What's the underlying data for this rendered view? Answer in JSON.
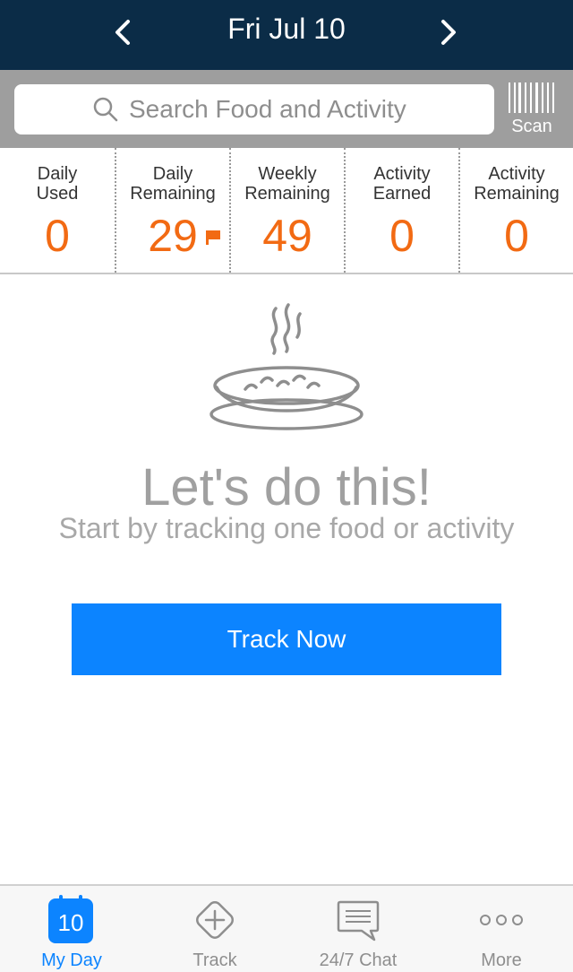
{
  "header": {
    "date": "Fri Jul 10",
    "prev_icon": "chevron-left-icon",
    "next_icon": "chevron-right-icon"
  },
  "search": {
    "placeholder": "Search Food and Activity",
    "scan_label": "Scan"
  },
  "stats": [
    {
      "title_1": "Daily",
      "title_2": "Used",
      "value": "0"
    },
    {
      "title_1": "Daily",
      "title_2": "Remaining",
      "value": "29"
    },
    {
      "title_1": "Weekly",
      "title_2": "Remaining",
      "value": "49"
    },
    {
      "title_1": "Activity",
      "title_2": "Earned",
      "value": "0"
    },
    {
      "title_1": "Activity",
      "title_2": "Remaining",
      "value": "0"
    }
  ],
  "empty_state": {
    "headline": "Let's do this!",
    "subline": "Start by tracking one food or activity",
    "button": "Track Now"
  },
  "tabs": [
    {
      "label": "My Day",
      "icon": "calendar-icon",
      "calendar_day": "10",
      "active": true
    },
    {
      "label": "Track",
      "icon": "plus-diamond-icon"
    },
    {
      "label": "24/7 Chat",
      "icon": "chat-bubble-icon"
    },
    {
      "label": "More",
      "icon": "more-dots-icon"
    }
  ],
  "colors": {
    "header_bg": "#0b2c47",
    "accent_blue": "#0c84ff",
    "value_orange": "#f26a13",
    "search_bg": "#9e9e9e"
  }
}
